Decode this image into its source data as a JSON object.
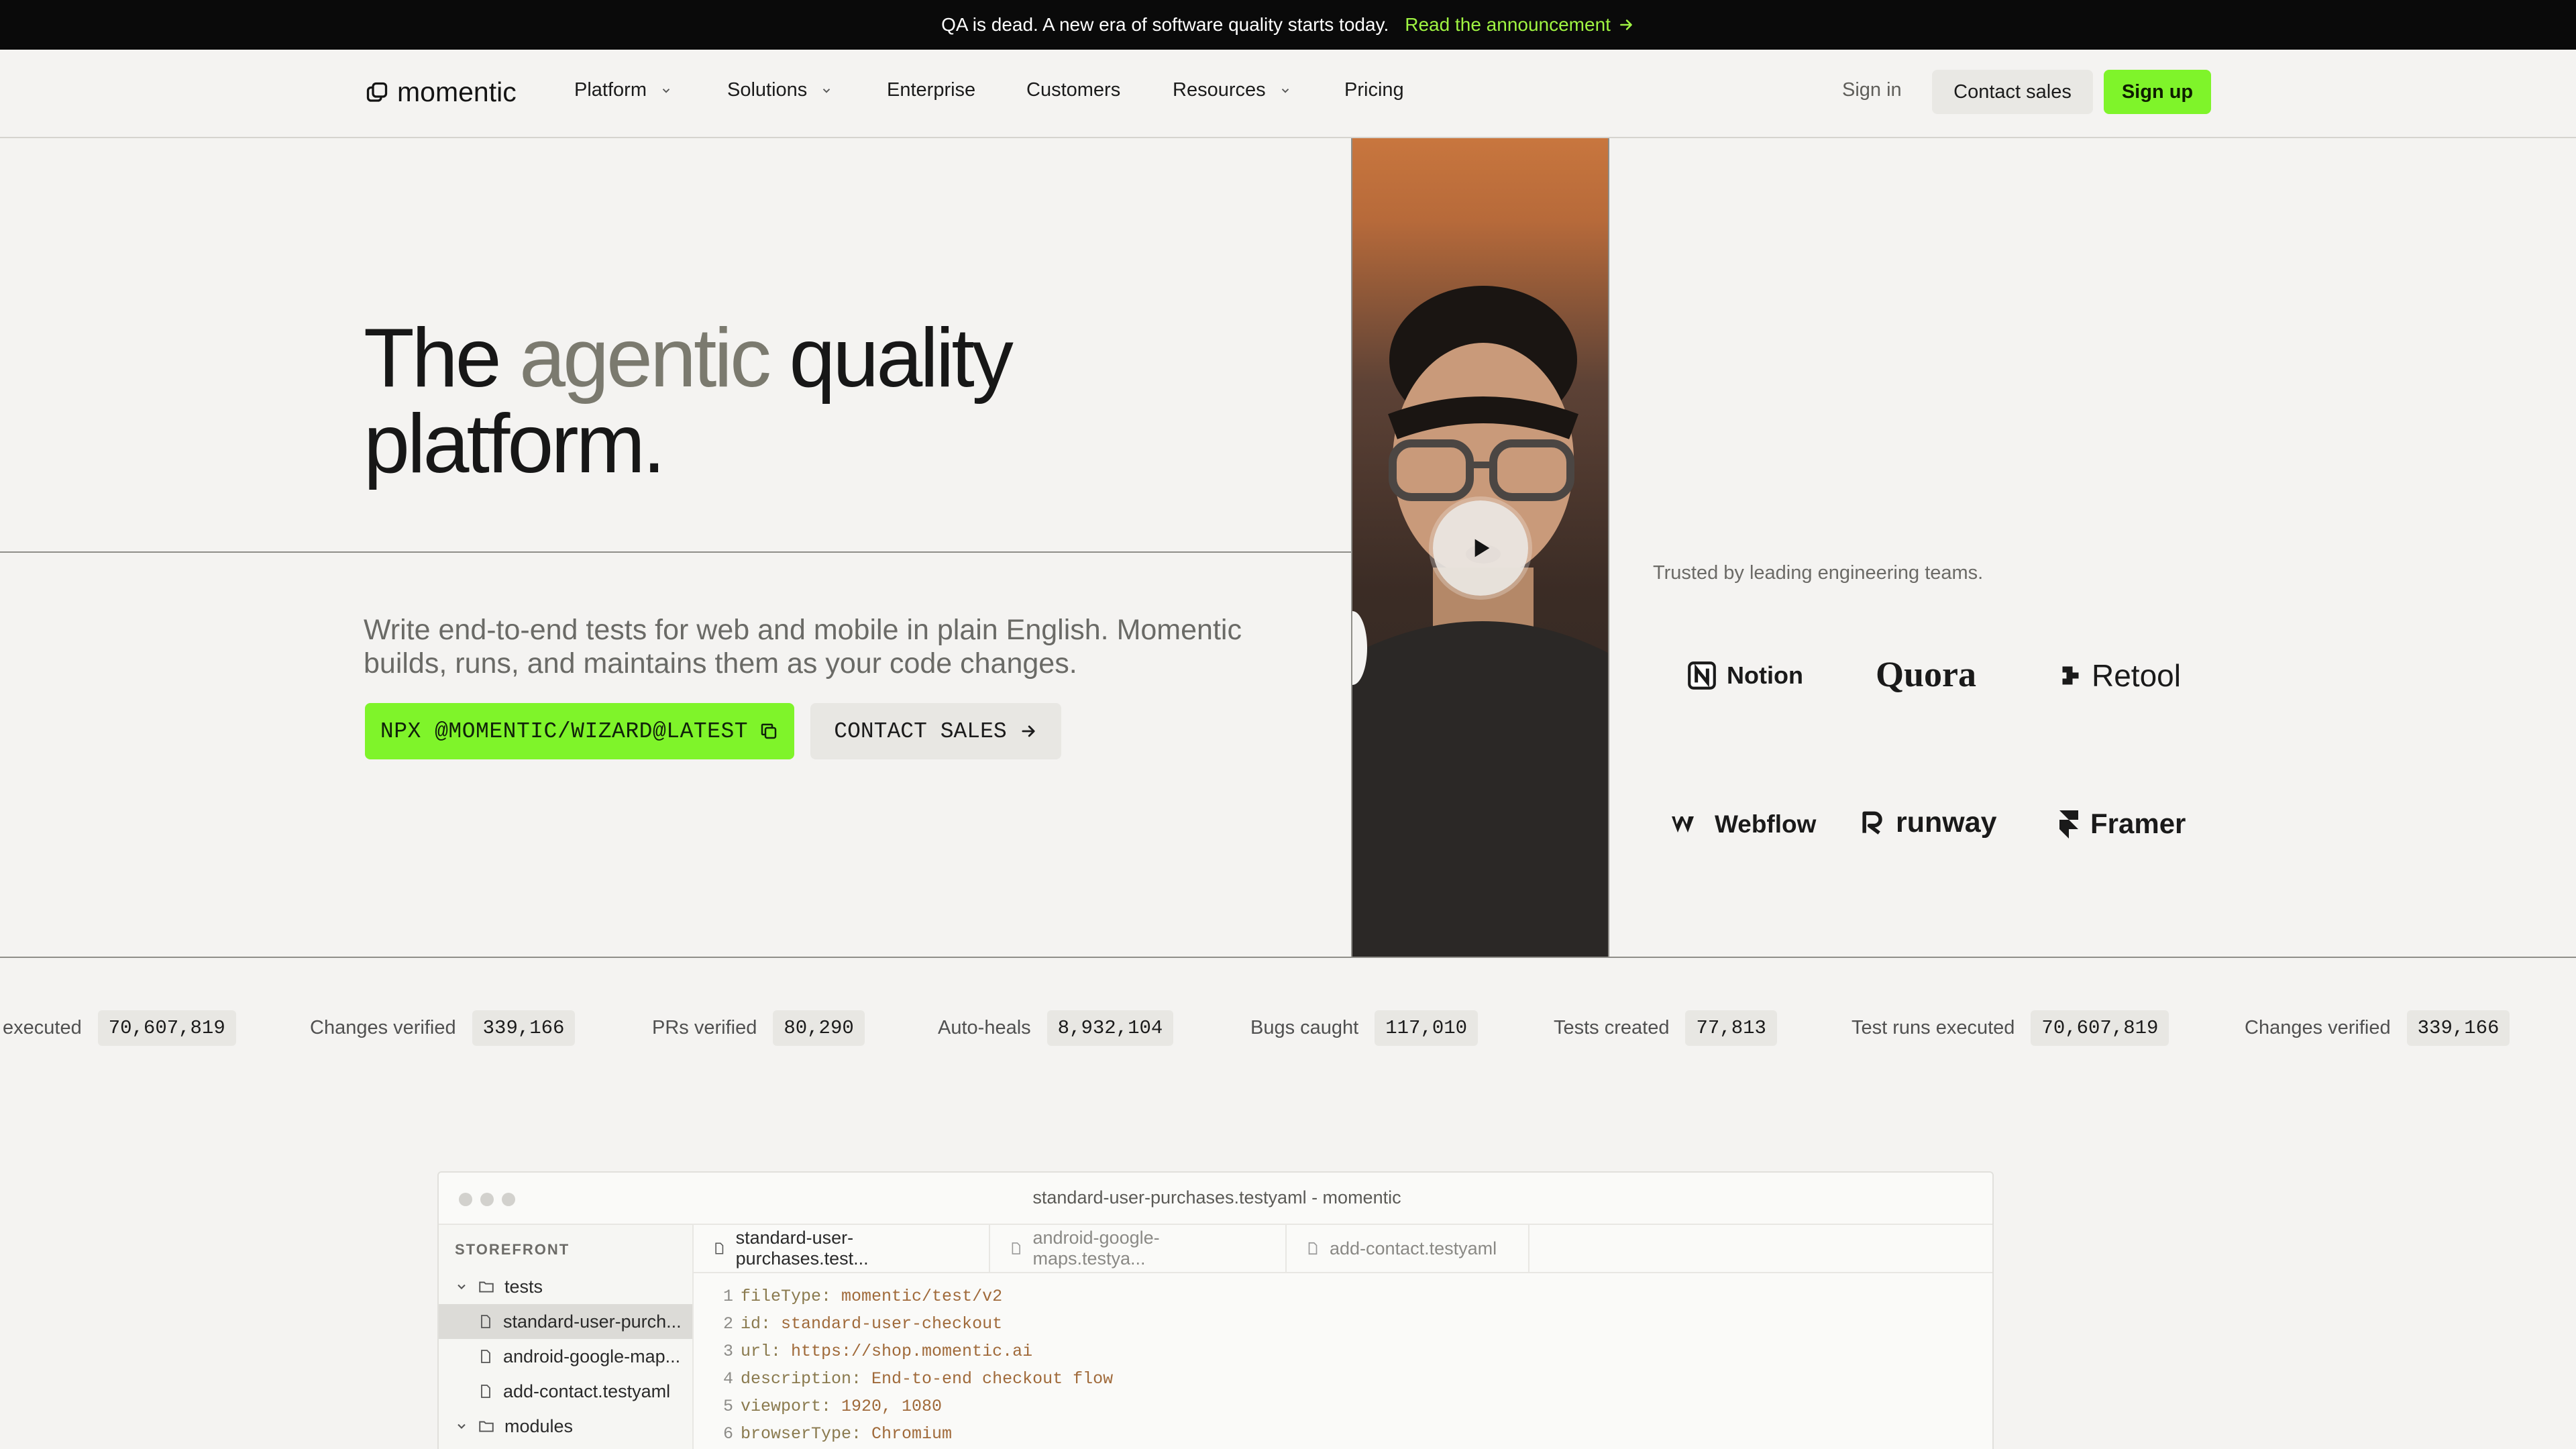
{
  "announcement": {
    "text": "QA is dead. A new era of software quality starts today.",
    "link": "Read the announcement"
  },
  "nav": {
    "logo": "momentic",
    "items": [
      {
        "label": "Platform",
        "dropdown": true
      },
      {
        "label": "Solutions",
        "dropdown": true
      },
      {
        "label": "Enterprise",
        "dropdown": false
      },
      {
        "label": "Customers",
        "dropdown": false
      },
      {
        "label": "Resources",
        "dropdown": true
      },
      {
        "label": "Pricing",
        "dropdown": false
      }
    ],
    "sign_in": "Sign in",
    "contact_sales": "Contact sales",
    "sign_up": "Sign up"
  },
  "hero": {
    "title_1": "The ",
    "title_accent": "agentic",
    "title_2": " quality",
    "title_3": "platform.",
    "subtitle": "Write end-to-end tests for web and mobile in plain English. Momentic builds, runs, and maintains them as your code changes.",
    "cta_primary": "NPX @MOMENTIC/WIZARD@LATEST",
    "cta_secondary": "CONTACT SALES"
  },
  "trusted": {
    "label": "Trusted by leading engineering teams.",
    "logos": [
      "Notion",
      "Quora",
      "Retool",
      "Webflow",
      "runway",
      "Framer"
    ]
  },
  "stats": [
    {
      "label": "executed",
      "value": "70,607,819"
    },
    {
      "label": "Changes verified",
      "value": "339,166"
    },
    {
      "label": "PRs verified",
      "value": "80,290"
    },
    {
      "label": "Auto-heals",
      "value": "8,932,104"
    },
    {
      "label": "Bugs caught",
      "value": "117,010"
    },
    {
      "label": "Tests created",
      "value": "77,813"
    },
    {
      "label": "Test runs executed",
      "value": "70,607,819"
    },
    {
      "label": "Changes verified",
      "value": "339,166"
    }
  ],
  "editor": {
    "window_title": "standard-user-purchases.testyaml - momentic",
    "sidebar_header": "STOREFRONT",
    "tree": [
      {
        "label": "tests",
        "type": "folder"
      },
      {
        "label": "standard-user-purch...",
        "type": "file"
      },
      {
        "label": "android-google-map...",
        "type": "file"
      },
      {
        "label": "add-contact.testyaml",
        "type": "file"
      },
      {
        "label": "modules",
        "type": "folder"
      }
    ],
    "tabs": [
      "standard-user-purchases.test...",
      "android-google-maps.testya...",
      "add-contact.testyaml"
    ],
    "code": [
      {
        "n": "1",
        "key": "fileType:",
        "val": " momentic/test/v2"
      },
      {
        "n": "2",
        "key": "id:",
        "val": " standard-user-checkout"
      },
      {
        "n": "3",
        "key": "url:",
        "val": " https://shop.momentic.ai"
      },
      {
        "n": "4",
        "key": "description:",
        "val": " End-to-end checkout flow"
      },
      {
        "n": "5",
        "key": "viewport:",
        "val": " 1920, 1080"
      },
      {
        "n": "6",
        "key": "browserType:",
        "val": " Chromium"
      }
    ]
  },
  "colors": {
    "accent": "#7ff42a",
    "announcement_link": "#9ff442",
    "background": "#f4f3f1"
  }
}
